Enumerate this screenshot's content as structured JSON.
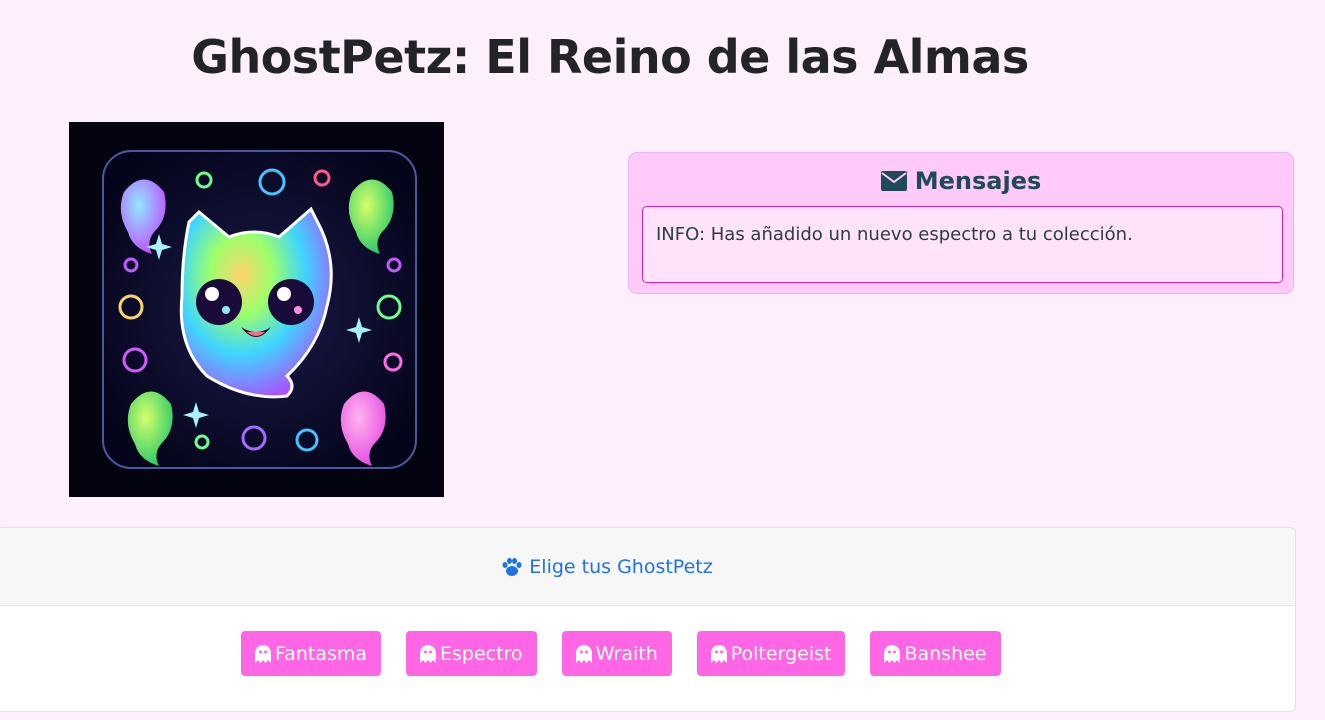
{
  "page": {
    "title": "GhostPetz: El Reino de las Almas"
  },
  "messages": {
    "header_icon": "envelope-icon",
    "header": "Mensajes",
    "items": [
      "INFO: Has añadido un nuevo espectro a tu colección."
    ]
  },
  "pets": {
    "header_icon": "paw-icon",
    "header_link": "Elige tus GhostPetz",
    "button_icon": "ghost-icon",
    "buttons": [
      "Fantasma",
      "Espectro",
      "Wraith",
      "Poltergeist",
      "Banshee"
    ],
    "button_color": "#ff66e5",
    "link_color": "#1e73e8"
  },
  "colors": {
    "background": "#fdeffb",
    "messages_bg": "#ffc9f8",
    "message_border": "#dd1fb0"
  }
}
